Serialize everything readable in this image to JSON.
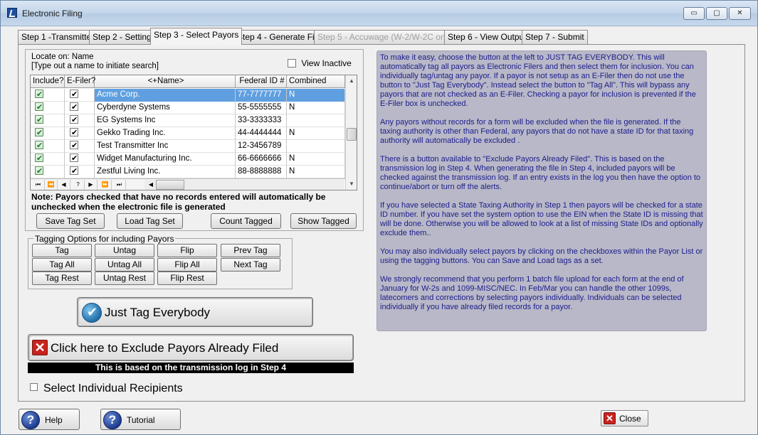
{
  "window": {
    "title": "Electronic Filing",
    "controls": {
      "minimize": "▭",
      "maximize": "▢",
      "close": "✕"
    }
  },
  "tabs": [
    {
      "label": "Step 1 -Transmitter",
      "state": "normal"
    },
    {
      "label": "Step 2 - Settings",
      "state": "normal"
    },
    {
      "label": "Step 3 - Select Payors",
      "state": "active"
    },
    {
      "label": "Step 4 - Generate File",
      "state": "normal"
    },
    {
      "label": "Step 5 - Accuwage (W-2/W-2C only)",
      "state": "disabled"
    },
    {
      "label": "Step 6 - View Output",
      "state": "normal"
    },
    {
      "label": "Step 7 - Submit",
      "state": "normal"
    }
  ],
  "locate": {
    "label": "Locate on: Name",
    "hint": "[Type out a name to initiate search]",
    "view_inactive": "View Inactive"
  },
  "grid": {
    "headers": [
      "Include?",
      "E-Filer?",
      "<+Name>",
      "Federal ID #",
      "Combined"
    ],
    "rows": [
      {
        "include": true,
        "efiler": true,
        "name": "Acme Corp.",
        "fedid": "77-7777777",
        "combined": "N",
        "selected": true
      },
      {
        "include": true,
        "efiler": true,
        "name": "Cyberdyne Systems",
        "fedid": "55-5555555",
        "combined": "N"
      },
      {
        "include": true,
        "efiler": true,
        "name": "EG Systems Inc",
        "fedid": "33-3333333",
        "combined": ""
      },
      {
        "include": true,
        "efiler": true,
        "name": "Gekko Trading Inc.",
        "fedid": "44-4444444",
        "combined": "N"
      },
      {
        "include": true,
        "efiler": true,
        "name": "Test Transmitter Inc",
        "fedid": "12-3456789",
        "combined": ""
      },
      {
        "include": true,
        "efiler": true,
        "name": "Widget Manufacturing Inc.",
        "fedid": "66-6666666",
        "combined": "N"
      },
      {
        "include": true,
        "efiler": true,
        "name": "Zestful Living Inc.",
        "fedid": "88-8888888",
        "combined": "N"
      }
    ],
    "nav": [
      "⏮",
      "⏪",
      "◀",
      "?",
      "▶",
      "⏩",
      "⏭",
      "◀"
    ]
  },
  "note": "Note: Payors checked that have no records entered will automatically be unchecked when the electronic file is generated",
  "tagset_buttons": {
    "save": "Save Tag Set",
    "load": "Load Tag Set",
    "count": "Count Tagged",
    "show": "Show Tagged"
  },
  "tagging": {
    "title": "Tagging Options for including Payors",
    "buttons": {
      "tag": "Tag",
      "untag": "Untag",
      "flip": "Flip",
      "prev_tag": "Prev Tag",
      "tag_all": "Tag All",
      "untag_all": "Untag All",
      "flip_all": "Flip All",
      "next_tag": "Next Tag",
      "tag_rest": "Tag Rest",
      "untag_rest": "Untag Rest",
      "flip_rest": "Flip Rest"
    }
  },
  "actions": {
    "just_tag": "Just Tag Everybody",
    "exclude": "Click here to Exclude Payors Already Filed",
    "exclude_note": "This is based on the transmission log in Step 4",
    "select_individual": "Select Individual Recipients"
  },
  "info": [
    "To make it easy, choose the button at the left to JUST TAG EVERYBODY.  This will automatically tag all payors as Electronic Filers and then select them for inclusion.   You can individually tag/untag any payor.   If a payor is not setup as an E-Filer then do not use the button to \"Just Tag Everybody\".   Instead select the button to \"Tag All\".  This will bypass any payors that are not checked as an E-Filer.   Checking a payor for inclusion is prevented if the E-Filer box is unchecked.",
    "Any payors without records for a form will be excluded when the file is generated.  If the taxing authority is other than Federal, any payors that do not have a state ID for that taxing authority will automatically be excluded  .",
    "There is a button available to \"Exclude Payors Already Filed\".   This is based on the transmission log in Step 4.  When generating the file in Step 4, included payors will be checked against the transmission log.   If an entry exists in the log you then have the option to continue/abort or turn off the alerts.",
    "If you have selected a State Taxing Authority in Step 1 then payors will be checked for a state ID number.  If you have set the system option to use the EIN when the State ID is missing that will be done.   Otherwise you will be allowed to look at a list of missing State IDs and optionally exclude them..",
    "You may also individually select payors by clicking on the checkboxes within the Payor List or using the tagging buttons.   You can Save and Load tags as a set.",
    "We strongly recommend that you perform 1 batch file upload for each form at the end of January for W-2s and 1099-MISC/NEC.   In Feb/Mar you can handle the other 1099s, latecomers and corrections by selecting payors individually.  Individuals can be selected individually if you have already filed records for a payor."
  ],
  "footer": {
    "help": "Help",
    "tutorial": "Tutorial",
    "close": "Close"
  }
}
